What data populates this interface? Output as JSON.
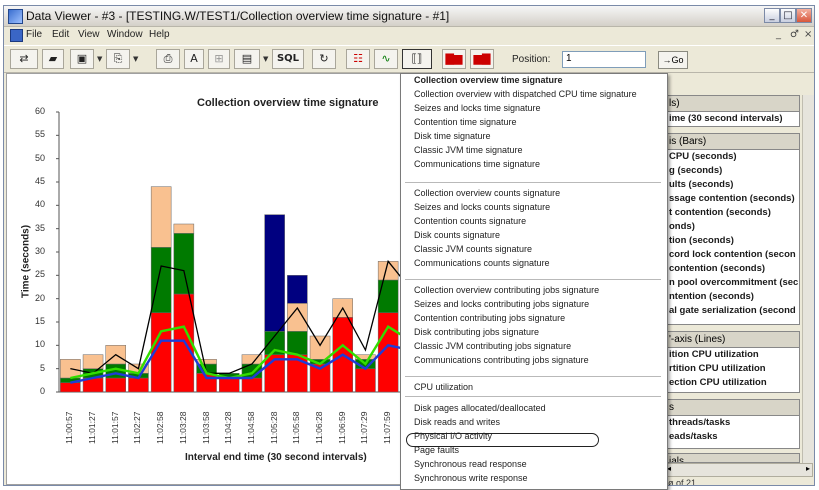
{
  "window": {
    "title": "Data Viewer - #3 - [TESTING.W/TEST1/Collection overview time signature - #1]",
    "min": "_",
    "max": "□",
    "close": "✕"
  },
  "menubar": {
    "items": [
      "File",
      "Edit",
      "View",
      "Window",
      "Help"
    ],
    "mdi": [
      "_",
      "♂",
      "×"
    ]
  },
  "toolbar": {
    "sql_label": "SQL",
    "position_label": "Position:",
    "position_value": "1",
    "go_label": "→Go"
  },
  "chart": {
    "title": "Collection overview time signature",
    "ylabel": "Time (seconds)",
    "xlabel": "Interval end time (30 second intervals)"
  },
  "chart_data": {
    "type": "bar",
    "title": "Collection overview time signature",
    "xlabel": "Interval end time (30 second intervals)",
    "ylabel": "Time (seconds)",
    "ylim": [
      0,
      60
    ],
    "y_ticks": [
      0,
      5,
      10,
      15,
      20,
      25,
      30,
      35,
      40,
      45,
      50,
      55,
      60
    ],
    "categories": [
      "11:00:57",
      "11:01:27",
      "11:01:57",
      "11:02:27",
      "11:02:58",
      "11:03:28",
      "11:03:58",
      "11:04:28",
      "11:04:58",
      "11:05:28",
      "11:05:58",
      "11:06:28",
      "11:06:59",
      "11:07:29",
      "11:07:59",
      "11:08:29"
    ],
    "colors": {
      "red": "#ff0000",
      "green": "#007a00",
      "tan": "#f9c190",
      "navy": "#000080",
      "lime": "#33dd00",
      "blue": "#1f3cd6",
      "black": "#000000"
    },
    "series": [
      {
        "color": "red",
        "values": [
          2,
          3,
          3,
          3,
          17,
          21,
          4,
          3,
          3,
          8,
          8,
          6,
          16,
          5,
          17,
          12
        ]
      },
      {
        "color": "green",
        "values": [
          1,
          2,
          3,
          1,
          14,
          13,
          2,
          1,
          3,
          5,
          5,
          1,
          0,
          2,
          7,
          12
        ]
      },
      {
        "color": "tan",
        "values": [
          4,
          3,
          4,
          2,
          13,
          2,
          1,
          0,
          2,
          0,
          6,
          5,
          4,
          1,
          4,
          1
        ]
      },
      {
        "color": "navy",
        "values": [
          0,
          0,
          0,
          0,
          0,
          0,
          0,
          0,
          0,
          25,
          6,
          0,
          0,
          0,
          0,
          0
        ]
      }
    ],
    "lines": [
      {
        "color": "black",
        "values": [
          5,
          4,
          8,
          5,
          27,
          26,
          4,
          4,
          6,
          12,
          18,
          10,
          18,
          9,
          28,
          22
        ]
      },
      {
        "color": "lime",
        "values": [
          3,
          4,
          5,
          4,
          13,
          14,
          4,
          3,
          4,
          9,
          8,
          6,
          10,
          6,
          14,
          11
        ]
      },
      {
        "color": "blue",
        "values": [
          2,
          3,
          4,
          3,
          11,
          11,
          3,
          3,
          3,
          7,
          7,
          5,
          8,
          5,
          10,
          9
        ]
      }
    ]
  },
  "side_panel": {
    "groups": [
      {
        "head": "ls)",
        "rows": [
          "ime (30 second intervals)"
        ]
      },
      {
        "head": "is (Bars)",
        "rows": [
          "CPU (seconds)",
          "g (seconds)",
          "ults (seconds)",
          "ssage contention (seconds)",
          "t contention (seconds)",
          "onds)",
          "tion (seconds)",
          "cord lock contention (secon",
          "contention (seconds)",
          "n pool overcommitment (sec",
          "ntention (seconds)",
          "al gate serialization (second"
        ]
      },
      {
        "head": "'-axis (Lines)",
        "rows": [
          "ition CPU utilization",
          "rtition CPU utilization",
          "ection CPU utilization"
        ]
      },
      {
        "head": "s",
        "rows": [
          "threads/tasks",
          "eads/tasks"
        ]
      },
      {
        "head": "ials",
        "rows": []
      }
    ],
    "footer": "ø of 21"
  },
  "dropdown": {
    "items": [
      "Collection overview time signature",
      "Collection overview with dispatched CPU time signature",
      "Seizes and locks time signature",
      "Contention time signature",
      "Disk time signature",
      "Classic JVM time signature",
      "Communications time signature",
      "Collection overview counts signature",
      "Seizes and locks counts signature",
      "Contention counts signature",
      "Disk counts signature",
      "Classic JVM counts signature",
      "Communications counts signature",
      "Collection overview contributing jobs signature",
      "Seizes and locks contributing jobs signature",
      "Contention contributing jobs signature",
      "Disk contributing jobs signature",
      "Classic JVM contributing jobs signature",
      "Communications contributing jobs signature",
      "CPU utilization",
      "Disk pages allocated/deallocated",
      "Disk reads and writes",
      "Physical I/O activity",
      "Page faults",
      "Synchronous read response",
      "Synchronous write response"
    ]
  }
}
